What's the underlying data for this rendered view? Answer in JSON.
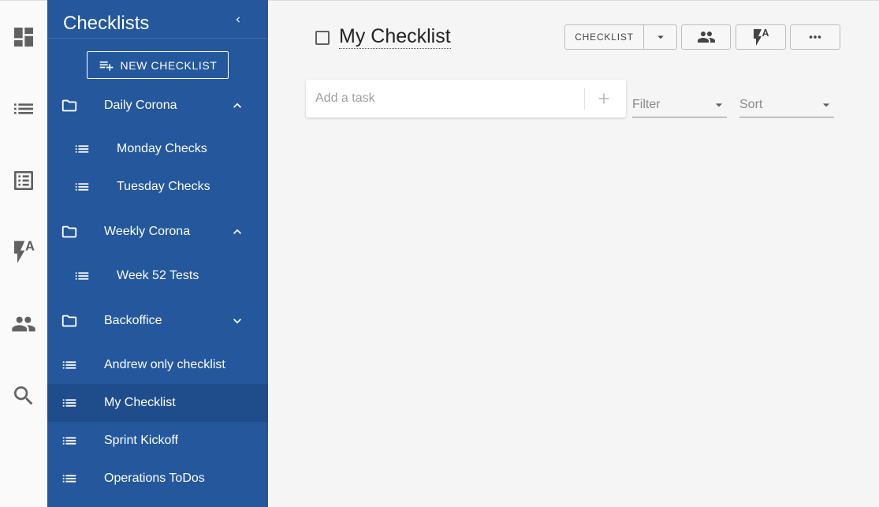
{
  "sidebar": {
    "title": "Checklists",
    "new_button_label": "NEW CHECKLIST",
    "items": [
      {
        "label": "Daily Corona"
      },
      {
        "label": "Monday Checks"
      },
      {
        "label": "Tuesday Checks"
      },
      {
        "label": "Weekly Corona"
      },
      {
        "label": "Week 52 Tests"
      },
      {
        "label": "Backoffice"
      },
      {
        "label": "Andrew only checklist"
      },
      {
        "label": "My Checklist"
      },
      {
        "label": "Sprint Kickoff"
      },
      {
        "label": "Operations ToDos"
      }
    ],
    "active_item": "My Checklist"
  },
  "rail": {
    "items": [
      "dashboard-icon",
      "list-icon",
      "list-alt-icon",
      "flash-auto-icon",
      "people-icon",
      "search-icon"
    ]
  },
  "main": {
    "checklist_title": "My Checklist",
    "type_button_label": "CHECKLIST",
    "add_task": {
      "placeholder": "Add a task",
      "value": ""
    },
    "filter_label": "Filter",
    "sort_label": "Sort"
  },
  "colors": {
    "sidebar_bg": "#24579b",
    "sidebar_active": "#1f4d8b",
    "rail_icon": "#616161"
  }
}
